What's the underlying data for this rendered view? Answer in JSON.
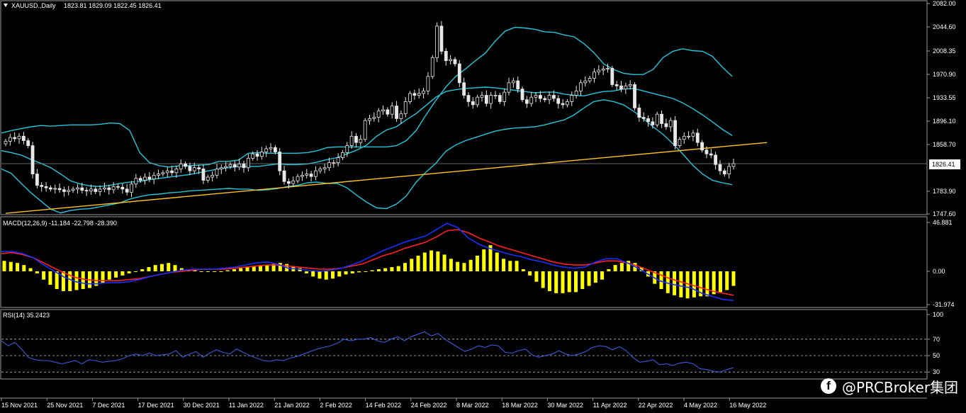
{
  "header": {
    "symbol_label": "XAUUSD.,Daily",
    "ohlc": "1823.81 1829.09 1822.45 1826.41"
  },
  "price_badge": "1826.41",
  "watermark": {
    "text": "@PRCBroker集团",
    "icon": "facebook-icon"
  },
  "colors": {
    "background": "#000000",
    "bull_candle": "#e8e8e8",
    "bear_candle": "#e8e8e8",
    "bollinger": "#26c6da",
    "trendline": "#ffc125",
    "macd_hist": "#ffff00",
    "macd_line": "#1a2fff",
    "signal_line": "#ff2020",
    "rsi_line": "#3a5bd9"
  },
  "chart_data": [
    {
      "type": "candlestick",
      "title": "XAUUSD.,Daily",
      "ylim": [
        1747.6,
        2082.0
      ],
      "y_ticks": [
        "2082.00",
        "2044.60",
        "2008.35",
        "1970.90",
        "1933.55",
        "1896.10",
        "1858.70",
        "1783.90",
        "1747.60"
      ],
      "x_ticks": [
        "15 Nov 2021",
        "25 Nov 2021",
        "7 Dec 2021",
        "17 Dec 2021",
        "30 Dec 2021",
        "11 Jan 2022",
        "21 Jan 2022",
        "2 Feb 2022",
        "14 Feb 2022",
        "24 Feb 2022",
        "8 Mar 2022",
        "18 Mar 2022",
        "30 Mar 2022",
        "11 Apr 2022",
        "22 Apr 2022",
        "4 May 2022",
        "16 May 2022"
      ],
      "current_price": 1826.41,
      "close": [
        1862,
        1868,
        1866,
        1870,
        1863,
        1855,
        1810,
        1792,
        1790,
        1788,
        1786,
        1787,
        1785,
        1782,
        1784,
        1786,
        1788,
        1784,
        1783,
        1786,
        1782,
        1786,
        1788,
        1785,
        1790,
        1789,
        1786,
        1781,
        1794,
        1803,
        1800,
        1805,
        1802,
        1808,
        1810,
        1812,
        1815,
        1812,
        1818,
        1826,
        1822,
        1815,
        1820,
        1818,
        1800,
        1805,
        1808,
        1818,
        1820,
        1822,
        1825,
        1821,
        1826,
        1820,
        1835,
        1842,
        1838,
        1845,
        1850,
        1852,
        1845,
        1815,
        1798,
        1795,
        1799,
        1806,
        1808,
        1810,
        1806,
        1815,
        1818,
        1820,
        1828,
        1828,
        1836,
        1844,
        1855,
        1870,
        1860,
        1865,
        1895,
        1898,
        1900,
        1910,
        1912,
        1905,
        1918,
        1898,
        1906,
        1925,
        1938,
        1935,
        1938,
        1942,
        1965,
        1995,
        2045,
        2005,
        1990,
        1992,
        1985,
        1955,
        1935,
        1925,
        1920,
        1932,
        1935,
        1922,
        1935,
        1935,
        1925,
        1940,
        1955,
        1958,
        1945,
        1928,
        1922,
        1932,
        1935,
        1930,
        1928,
        1935,
        1930,
        1922,
        1920,
        1925,
        1935,
        1942,
        1955,
        1958,
        1962,
        1972,
        1975,
        1977,
        1978,
        1952,
        1950,
        1945,
        1950,
        1952,
        1915,
        1900,
        1898,
        1893,
        1888,
        1905,
        1890,
        1885,
        1895,
        1855,
        1865,
        1870,
        1870,
        1875,
        1860,
        1848,
        1842,
        1840,
        1825,
        1815,
        1810,
        1822,
        1826.41
      ],
      "bollinger_upper": [
        1875,
        1879,
        1882,
        1885,
        1887,
        1886,
        1887,
        1888,
        1888,
        1888,
        1889,
        1891,
        1890,
        1879,
        1844,
        1828,
        1823,
        1821,
        1823,
        1823,
        1824,
        1825,
        1830,
        1830,
        1832,
        1843,
        1844,
        1843,
        1843,
        1843,
        1843,
        1844,
        1847,
        1852,
        1853,
        1853,
        1853,
        1853,
        1853,
        1853,
        1855,
        1863,
        1879,
        1904,
        1927,
        1948,
        1965,
        1977,
        1990,
        2002,
        2021,
        2037,
        2043,
        2042,
        2040,
        2036,
        2035,
        2031,
        2028,
        2017,
        2003,
        1985,
        1976,
        1970,
        1968,
        1968,
        1976,
        1995,
        2005,
        2009,
        2006,
        2005,
        1997,
        1980,
        1965
      ],
      "bollinger_middle": [
        1847,
        1844,
        1840,
        1833,
        1827,
        1820,
        1810,
        1799,
        1794,
        1791,
        1790,
        1792,
        1795,
        1797,
        1798,
        1801,
        1803,
        1805,
        1807,
        1809,
        1812,
        1815,
        1818,
        1820,
        1822,
        1822,
        1822,
        1824,
        1826,
        1825,
        1825,
        1826,
        1829,
        1833,
        1836,
        1842,
        1848,
        1856,
        1870,
        1880,
        1885,
        1896,
        1906,
        1919,
        1932,
        1941,
        1944,
        1946,
        1947,
        1948,
        1947,
        1945,
        1943,
        1941,
        1939,
        1940,
        1940,
        1937,
        1935,
        1934,
        1938,
        1941,
        1942,
        1945,
        1946,
        1942,
        1938,
        1934,
        1930,
        1923,
        1914,
        1904,
        1893,
        1881,
        1871
      ],
      "bollinger_lower": [
        1818,
        1811,
        1795,
        1780,
        1767,
        1754,
        1748,
        1752,
        1754,
        1755,
        1758,
        1761,
        1764,
        1770,
        1774,
        1777,
        1778,
        1780,
        1781,
        1783,
        1784,
        1785,
        1786,
        1787,
        1786,
        1786,
        1784,
        1785,
        1787,
        1790,
        1792,
        1796,
        1797,
        1795,
        1795,
        1788,
        1776,
        1765,
        1756,
        1755,
        1762,
        1775,
        1797,
        1813,
        1827,
        1846,
        1856,
        1863,
        1868,
        1873,
        1878,
        1881,
        1883,
        1884,
        1885,
        1888,
        1892,
        1896,
        1904,
        1915,
        1925,
        1928,
        1925,
        1920,
        1910,
        1898,
        1885,
        1873,
        1858,
        1842,
        1824,
        1810,
        1800,
        1796,
        1793
      ],
      "trendline": {
        "from": [
          0,
          1747.5
        ],
        "to": [
          160,
          1860
        ]
      }
    },
    {
      "type": "histogram+line",
      "title": "MACD(12,26,9) -11.184 -22.798 -28.390",
      "ylim": [
        -31.974,
        46.881
      ],
      "y_ticks": [
        "46.881",
        "0.00",
        "-31.974"
      ],
      "histogram": [
        10,
        9,
        8,
        6,
        3,
        -2,
        -8,
        -13,
        -17,
        -19,
        -19,
        -18,
        -17,
        -16,
        -14,
        -11,
        -8,
        -6,
        -4,
        -2,
        0,
        2,
        4,
        6,
        7,
        8,
        6,
        3,
        2,
        1,
        0,
        0,
        0,
        0,
        1,
        2,
        3,
        4,
        5,
        6,
        6,
        7,
        8,
        7,
        5,
        3,
        -2,
        -5,
        -7,
        -8,
        -7,
        -5,
        -3,
        -2,
        -1,
        0,
        1,
        2,
        3,
        4,
        5,
        8,
        12,
        15,
        18,
        20,
        19,
        16,
        12,
        9,
        8,
        11,
        15,
        21,
        25,
        18,
        12,
        10,
        10,
        2,
        -4,
        -10,
        -16,
        -19,
        -21,
        -21,
        -20,
        -20,
        -17,
        -14,
        -11,
        -8,
        2,
        6,
        8,
        10,
        8,
        4,
        -5,
        -12,
        -17,
        -21,
        -23,
        -25,
        -26,
        -25,
        -24,
        -24,
        -22,
        -20,
        -18,
        -14
      ],
      "macd": [
        19,
        19,
        17,
        13,
        6,
        0,
        -6,
        -10,
        -12,
        -12,
        -11,
        -11,
        -10,
        -8,
        -5,
        -3,
        -1,
        1,
        2,
        2,
        2,
        3,
        4,
        6,
        8,
        9,
        7,
        3,
        2,
        1,
        0,
        1,
        3,
        6,
        10,
        15,
        20,
        24,
        28,
        31,
        34,
        40,
        46,
        42,
        32,
        26,
        22,
        19,
        16,
        14,
        11,
        9,
        6,
        4,
        3,
        4,
        9,
        12,
        12,
        8,
        3,
        -3,
        -9,
        -12,
        -14,
        -16,
        -21,
        -24,
        -27,
        -28
      ],
      "signal": [
        17,
        18,
        16,
        13,
        8,
        3,
        -2,
        -6,
        -8,
        -9,
        -9,
        -9,
        -8,
        -7,
        -5,
        -3,
        -1,
        0,
        1,
        2,
        2,
        2,
        3,
        4,
        5,
        6,
        6,
        5,
        4,
        3,
        2,
        2,
        3,
        5,
        7,
        11,
        15,
        18,
        22,
        25,
        28,
        33,
        39,
        40,
        37,
        32,
        28,
        24,
        21,
        18,
        15,
        12,
        9,
        7,
        6,
        6,
        8,
        10,
        10,
        8,
        5,
        1,
        -3,
        -7,
        -10,
        -13,
        -16,
        -19,
        -21,
        -23
      ]
    },
    {
      "type": "line",
      "title": "RSI(14) 35.2423",
      "ylim": [
        0,
        100
      ],
      "y_ticks": [
        "100",
        "70",
        "50",
        "30"
      ],
      "levels": [
        70,
        50,
        30
      ],
      "values": [
        68,
        62,
        66,
        58,
        48,
        45,
        44,
        44,
        42,
        40,
        42,
        44,
        40,
        45,
        44,
        42,
        43,
        44,
        46,
        50,
        52,
        50,
        53,
        50,
        51,
        52,
        56,
        48,
        52,
        55,
        48,
        53,
        57,
        54,
        52,
        58,
        54,
        50,
        47,
        44,
        43,
        45,
        44,
        47,
        49,
        52,
        55,
        58,
        60,
        62,
        65,
        70,
        68,
        70,
        70,
        72,
        68,
        66,
        70,
        73,
        68,
        73,
        76,
        79,
        74,
        77,
        70,
        65,
        60,
        55,
        58,
        62,
        60,
        63,
        62,
        54,
        53,
        56,
        58,
        51,
        48,
        50,
        52,
        56,
        52,
        50,
        52,
        55,
        60,
        62,
        61,
        57,
        61,
        56,
        48,
        42,
        43,
        45,
        39,
        40,
        38,
        41,
        42,
        40,
        34,
        33,
        31,
        30,
        33,
        35.2
      ]
    }
  ]
}
